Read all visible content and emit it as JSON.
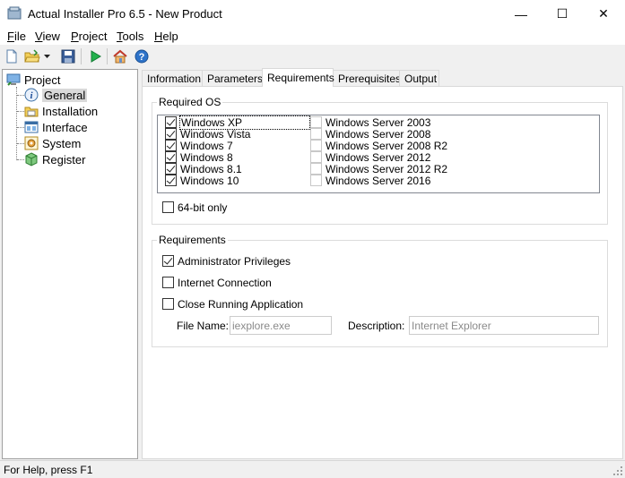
{
  "window": {
    "title": "Actual Installer Pro 6.5 - New Product",
    "minimize_glyph": "—",
    "maximize_glyph": "☐",
    "close_glyph": "✕"
  },
  "menu": {
    "items": [
      {
        "label_rest": "ile",
        "accel": "F"
      },
      {
        "label_rest": "iew",
        "accel": "V"
      },
      {
        "label_rest": "roject",
        "accel": "P"
      },
      {
        "label_rest": "ools",
        "accel": "T"
      },
      {
        "label_rest": "elp",
        "accel": "H"
      }
    ]
  },
  "toolbar": {
    "icons": [
      "new-file-icon",
      "open-folder-icon",
      "dropdown-arrow-icon",
      "save-icon",
      "build-run-icon",
      "home-icon",
      "help-icon"
    ]
  },
  "tree": {
    "root": "Project",
    "items": [
      "General",
      "Installation",
      "Interface",
      "System",
      "Register"
    ],
    "selected": "General"
  },
  "tabs": {
    "labels": [
      "Information",
      "Parameters",
      "Requirements",
      "Prerequisites",
      "Output"
    ],
    "active": "Requirements"
  },
  "required_os": {
    "title": "Required OS",
    "left": [
      {
        "label": "Windows XP",
        "checked": true
      },
      {
        "label": "Windows Vista",
        "checked": true
      },
      {
        "label": "Windows 7",
        "checked": true
      },
      {
        "label": "Windows 8",
        "checked": true
      },
      {
        "label": "Windows 8.1",
        "checked": true
      },
      {
        "label": "Windows 10",
        "checked": true
      }
    ],
    "right": [
      {
        "label": "Windows Server 2003",
        "checked": false
      },
      {
        "label": "Windows Server 2008",
        "checked": false
      },
      {
        "label": "Windows Server 2008 R2",
        "checked": false
      },
      {
        "label": "Windows Server 2012",
        "checked": false
      },
      {
        "label": "Windows Server 2012 R2",
        "checked": false
      },
      {
        "label": "Windows Server 2016",
        "checked": false
      }
    ],
    "bit64": {
      "label": "64-bit only",
      "checked": false
    }
  },
  "requirements": {
    "title": "Requirements",
    "admin": {
      "label": "Administrator Privileges",
      "checked": true
    },
    "internet": {
      "label": "Internet Connection",
      "checked": false
    },
    "close_app": {
      "label": "Close Running Application",
      "checked": false
    },
    "file_name_label": "File Name:",
    "file_name_value": "iexplore.exe",
    "description_label": "Description:",
    "description_value": "Internet Explorer"
  },
  "status": {
    "text": "For Help, press F1"
  }
}
